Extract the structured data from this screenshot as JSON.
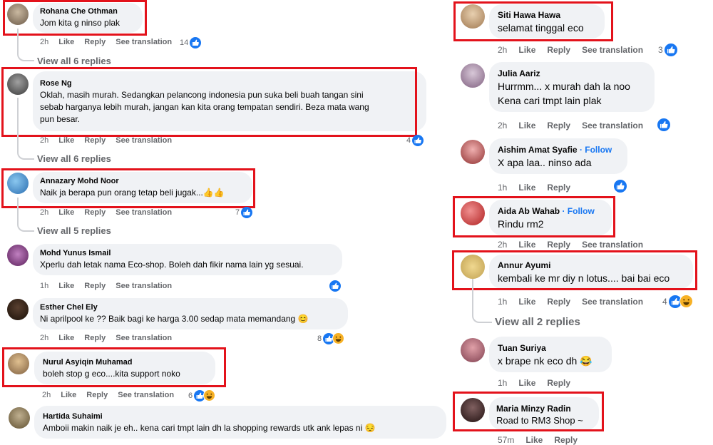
{
  "left_comments": [
    {
      "name": "Rohana Che Othman",
      "text": "Jom kita g ninso plak",
      "time": "2h",
      "like": "Like",
      "reply": "Reply",
      "translate": "See translation",
      "count": "14",
      "view_all": "View all 6 replies"
    },
    {
      "name": "Rose Ng",
      "text1": "Oklah, masih murah. Sedangkan pelancong indonesia pun suka beli buah tangan sini",
      "text2": "sebab harganya lebih murah, jangan kan kita orang tempatan sendiri. Beza mata wang",
      "text3": "pun besar.",
      "time": "2h",
      "like": "Like",
      "reply": "Reply",
      "translate": "See translation",
      "count": "4",
      "view_all": "View all 6 replies"
    },
    {
      "name": "Annazary Mohd Noor",
      "text": "Naik ja berapa pun orang tetap beli jugak...",
      "emoji": "👍👍",
      "time": "2h",
      "like": "Like",
      "reply": "Reply",
      "translate": "See translation",
      "count": "7",
      "view_all": "View all 5 replies"
    },
    {
      "name": "Mohd Yunus Ismail",
      "text": "Xperlu dah letak nama Eco-shop. Boleh dah fikir nama lain yg sesuai.",
      "time": "1h",
      "like": "Like",
      "reply": "Reply",
      "translate": "See translation"
    },
    {
      "name": "Esther Chel Ely",
      "text": "Ni aprilpool ke ?? Baik bagi ke harga 3.00 sedap mata memandang",
      "emoji": "😊",
      "time": "2h",
      "like": "Like",
      "reply": "Reply",
      "translate": "See translation",
      "count": "8"
    },
    {
      "name": "Nurul Asyiqin Muhamad",
      "text": "boleh stop g eco....kita support noko",
      "time": "2h",
      "like": "Like",
      "reply": "Reply",
      "translate": "See translation",
      "count": "6"
    },
    {
      "name": "Hartida Suhaimi",
      "text": "Amboii makin naik je eh.. kena cari tmpt lain dh la shopping rewards utk ank lepas ni",
      "emoji": "😔"
    }
  ],
  "right_comments": [
    {
      "name": "Siti Hawa Hawa",
      "text": "selamat tinggal eco",
      "time": "2h",
      "like": "Like",
      "reply": "Reply",
      "translate": "See translation",
      "count": "3"
    },
    {
      "name": "Julia Aariz",
      "text1": "Hurrmm... x murah dah la noo",
      "text2": "Kena cari tmpt lain plak",
      "time": "2h",
      "like": "Like",
      "reply": "Reply",
      "translate": "See translation"
    },
    {
      "name": "Aishim Amat Syafie",
      "follow": "· Follow",
      "text": "X apa laa.. ninso ada",
      "time": "1h",
      "like": "Like",
      "reply": "Reply"
    },
    {
      "name": "Aida Ab Wahab",
      "follow": "· Follow",
      "text": "Rindu rm2",
      "time": "2h",
      "like": "Like",
      "reply": "Reply",
      "translate": "See translation"
    },
    {
      "name": "Annur Ayumi",
      "text": "kembali ke mr diy n lotus.... bai bai eco",
      "time": "1h",
      "like": "Like",
      "reply": "Reply",
      "translate": "See translation",
      "count": "4",
      "view_all": "View all 2 replies"
    },
    {
      "name": "Tuan Suriya",
      "text": "x brape nk eco dh",
      "emoji": "😂",
      "time": "1h",
      "like": "Like",
      "reply": "Reply"
    },
    {
      "name": "Maria Minzy Radin",
      "text": "Road to RM3 Shop ~",
      "time": "57m",
      "like": "Like",
      "reply": "Reply"
    }
  ],
  "colors": {
    "highlight": "#e3121b",
    "bubble": "#f0f2f5",
    "like_blue": "#1877f2",
    "meta_grey": "#65676b"
  }
}
